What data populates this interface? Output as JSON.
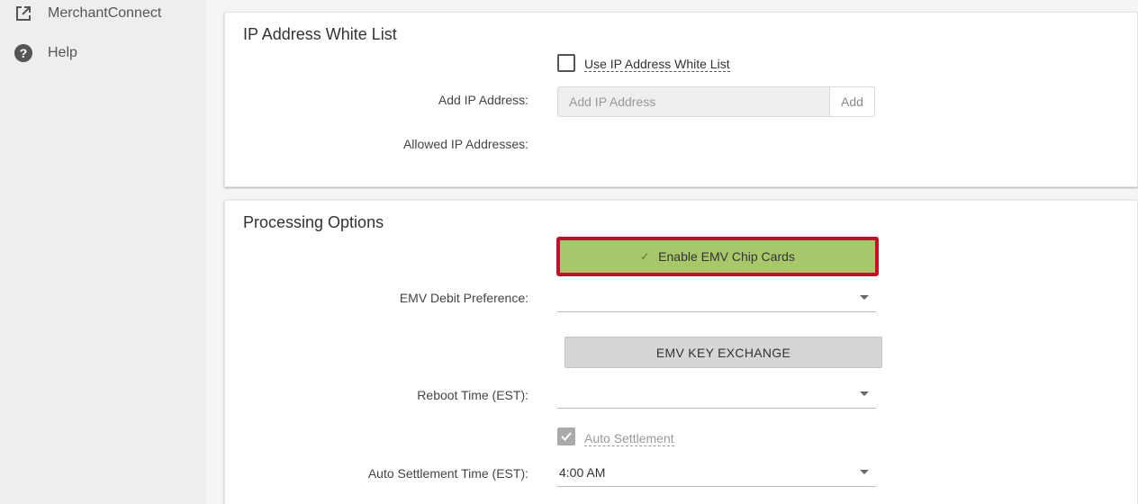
{
  "sidebar": {
    "items": [
      {
        "label": "MerchantConnect",
        "icon": "external-link-icon"
      },
      {
        "label": "Help",
        "icon": "help-circle-icon"
      }
    ]
  },
  "ip_whitelist": {
    "title": "IP Address White List",
    "use_whitelist_label": "Use IP Address White List",
    "use_whitelist_checked": false,
    "add_ip_label": "Add IP Address:",
    "add_ip_placeholder": "Add IP Address",
    "add_ip_value": "",
    "add_button": "Add",
    "allowed_label": "Allowed IP Addresses:"
  },
  "processing": {
    "title": "Processing Options",
    "emv_chip_button": "Enable EMV Chip Cards",
    "emv_debit_label": "EMV Debit Preference:",
    "emv_debit_value": "",
    "emv_key_exchange": "EMV KEY EXCHANGE",
    "reboot_label": "Reboot Time (EST):",
    "reboot_value": "",
    "auto_settlement_label": "Auto Settlement",
    "auto_settlement_checked": true,
    "auto_settlement_time_label": "Auto Settlement Time (EST):",
    "auto_settlement_time_value": "4:00 AM"
  },
  "colors": {
    "emv_button_bg": "#a8c76a",
    "highlight_border": "#c0112b"
  }
}
